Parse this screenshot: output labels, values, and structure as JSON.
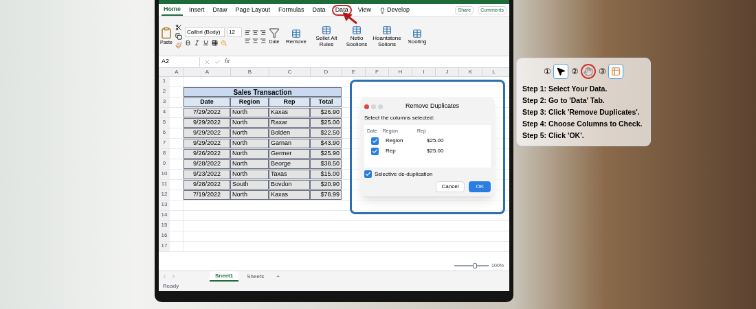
{
  "ribbon_tabs": [
    {
      "label": "Home",
      "selected": true,
      "highlighted": false
    },
    {
      "label": "Insert",
      "selected": false,
      "highlighted": false
    },
    {
      "label": "Draw",
      "selected": false,
      "highlighted": false
    },
    {
      "label": "Page Layout",
      "selected": false,
      "highlighted": false
    },
    {
      "label": "Formulas",
      "selected": false,
      "highlighted": false
    },
    {
      "label": "Data",
      "selected": false,
      "highlighted": false
    },
    {
      "label": "Data",
      "selected": false,
      "highlighted": true
    },
    {
      "label": "View",
      "selected": false,
      "highlighted": false
    },
    {
      "label": "Develop",
      "selected": false,
      "highlighted": false
    }
  ],
  "share_button": "Share",
  "comments_button": "Comments",
  "ribbon": {
    "paste_label": "Paste",
    "font_name": "Calibri (Body)",
    "font_size": "12",
    "date_label": "Date",
    "tools": [
      "Remove",
      "Sellet Alt Rules",
      "Netio Soolions",
      "Hoantatone Solions",
      "Sooting"
    ]
  },
  "formula_bar": {
    "name_box": "A2",
    "fx": "fx"
  },
  "corner_label": "A",
  "columns": [
    "A",
    "B",
    "C",
    "D",
    "E",
    "F",
    "H",
    "I",
    "J",
    "K",
    "L"
  ],
  "row_numbers": [
    "1",
    "2",
    "3",
    "4",
    "5",
    "6",
    "7",
    "8",
    "9",
    "10",
    "11",
    "12",
    "13",
    "14",
    "15",
    "16",
    "17"
  ],
  "table": {
    "title": "Sales Transaction",
    "columns": [
      "Date",
      "Region",
      "Rep",
      "Total"
    ],
    "rows": [
      [
        "7/29/2022",
        "North",
        "Kaxas",
        "$26.90"
      ],
      [
        "9/29/2022",
        "North",
        "Raxar",
        "$25.00"
      ],
      [
        "9/29/2022",
        "North",
        "Bolden",
        "$22.50"
      ],
      [
        "9/29/2022",
        "North",
        "Garnan",
        "$43.90"
      ],
      [
        "9/26/2022",
        "North",
        "Germer",
        "$25.90"
      ],
      [
        "9/28/2022",
        "North",
        "Beorge",
        "$38.50"
      ],
      [
        "9/23/2022",
        "North",
        "Taxas",
        "$15.00"
      ],
      [
        "9/28/2022",
        "South",
        "Bovdon",
        "$20.90"
      ],
      [
        "7/19/2022",
        "North",
        "Kaxas",
        "$78.99"
      ]
    ]
  },
  "dialog": {
    "title": "Remove Duplicates",
    "prompt": "Select the columns selected:",
    "headers": [
      "Date",
      "Region",
      "Rep"
    ],
    "items": [
      {
        "label": "Region",
        "value": "$25.00",
        "checked": true
      },
      {
        "label": "Rep",
        "value": "$25.00",
        "checked": true
      }
    ],
    "option": {
      "label": "Selective de-duplication",
      "checked": true
    },
    "cancel": "Cancel",
    "ok": "OK"
  },
  "sheet_tabs": [
    {
      "label": "Sneet1",
      "selected": true
    },
    {
      "label": "Sheets",
      "selected": false
    }
  ],
  "add_sheet": "+",
  "status": "Ready",
  "zoom": {
    "level": 0.6,
    "reading": "100%"
  },
  "steps_panel": {
    "icons": [
      {
        "number": "①",
        "highlighted": false
      },
      {
        "number": "②",
        "highlighted": true
      },
      {
        "number": "③",
        "highlighted": false
      }
    ],
    "steps": [
      "Step 1: Select Your Data.",
      "Step 2: Go to 'Data' Tab.",
      "Step 3: Click 'Remove Duplicates'.",
      "Step 4: Choose Columns to Check.",
      "Step 5: Click 'OK'."
    ]
  }
}
